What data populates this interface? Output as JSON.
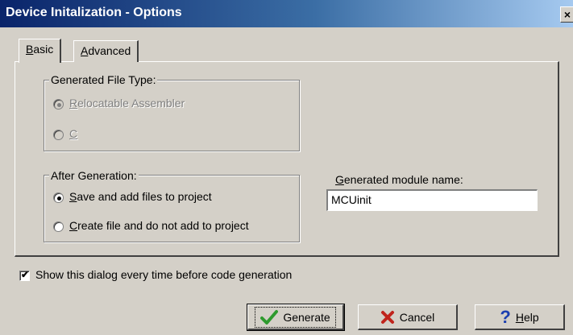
{
  "window": {
    "title": "Device Initalization - Options",
    "close_glyph": "×"
  },
  "tabs": [
    {
      "label_prefix": "",
      "label_accel": "B",
      "label_rest": "asic"
    },
    {
      "label_prefix": "",
      "label_accel": "A",
      "label_rest": "dvanced"
    }
  ],
  "file_type": {
    "legend": "Generated File Type:",
    "options": [
      {
        "accel": "R",
        "rest": "elocatable Assembler"
      },
      {
        "accel": "C",
        "rest": ""
      }
    ]
  },
  "after_gen": {
    "legend": "After Generation:",
    "options": [
      {
        "accel": "S",
        "rest": "ave and add files to project"
      },
      {
        "accel": "C",
        "rest": "reate file and do not add to project"
      }
    ]
  },
  "module_name": {
    "label_accel": "G",
    "label_rest": "enerated module name:",
    "value": "MCUinit"
  },
  "show_dialog": {
    "label": "Show this dialog every time before code generation"
  },
  "buttons": {
    "generate": "Generate",
    "cancel": "Cancel",
    "help_accel": "H",
    "help_rest": "elp"
  },
  "colors": {
    "check_green": "#2e9a2e",
    "cancel_red": "#c0241c",
    "help_blue": "#1b3fb0"
  }
}
